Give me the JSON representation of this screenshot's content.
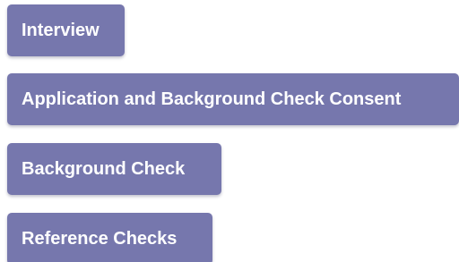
{
  "theme": {
    "button_bg": "#7677ad",
    "button_text": "#ffffff"
  },
  "steps": [
    {
      "label": "Interview"
    },
    {
      "label": "Application and Background Check Consent"
    },
    {
      "label": "Background Check"
    },
    {
      "label": "Reference Checks"
    }
  ]
}
